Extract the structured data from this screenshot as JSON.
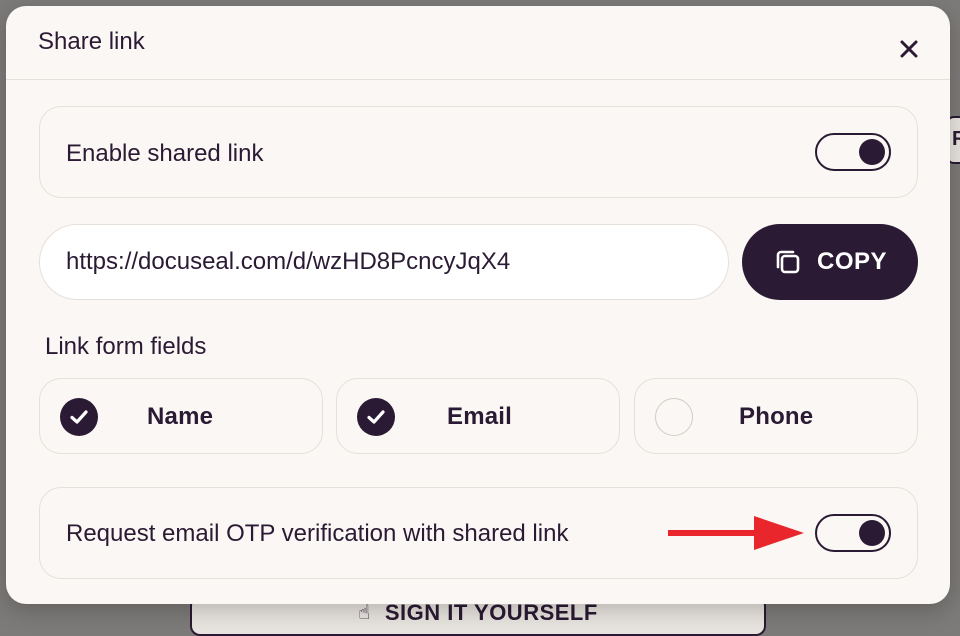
{
  "background": {
    "sign_button_label": "SIGN IT YOURSELF",
    "edge_button_letter": "R"
  },
  "modal": {
    "title": "Share link",
    "enable_shared_link": {
      "label": "Enable shared link",
      "enabled": true
    },
    "link": {
      "url": "https://docuseal.com/d/wzHD8PcncyJqX4",
      "copy_label": "COPY"
    },
    "form_fields": {
      "label": "Link form fields",
      "fields": [
        {
          "label": "Name",
          "checked": true
        },
        {
          "label": "Email",
          "checked": true
        },
        {
          "label": "Phone",
          "checked": false
        }
      ]
    },
    "otp": {
      "label": "Request email OTP verification with shared link",
      "enabled": true
    }
  },
  "colors": {
    "primary": "#2a1a33",
    "surface": "#faf7f4",
    "border": "#e6e0da",
    "arrow": "#e8262c"
  },
  "icons": {
    "close": "close-icon",
    "copy": "copy-icon",
    "check": "check-icon",
    "arrow": "arrow-right-icon"
  }
}
